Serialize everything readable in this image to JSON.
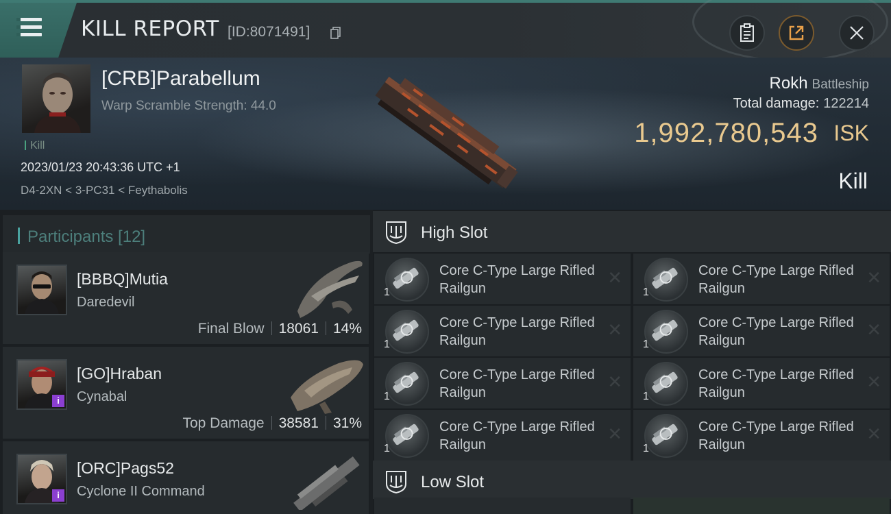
{
  "header": {
    "title": "KILL REPORT",
    "kill_id": "[ID:8071491]"
  },
  "victim": {
    "name": "[CRB]Parabellum",
    "sub": "Warp Scramble Strength: 44.0",
    "tag": "Kill",
    "time": "2023/01/23 20:43:36 UTC +1",
    "location": "D4-2XN < 3-PC31 < Feythabolis",
    "ship_name": "Rokh",
    "ship_class": "Battleship",
    "total_damage_label": "Total damage:",
    "total_damage": "122214",
    "isk_value": "1,992,780,543",
    "isk_unit": "ISK",
    "result": "Kill"
  },
  "participants": {
    "label": "Participants [12]",
    "items": [
      {
        "name": "[BBBQ]Mutia",
        "ship": "Daredevil",
        "stat_label": "Final Blow",
        "damage": "18061",
        "percent": "14%"
      },
      {
        "name": "[GO]Hraban",
        "ship": "Cynabal",
        "stat_label": "Top Damage",
        "damage": "38581",
        "percent": "31%",
        "badge": "i"
      },
      {
        "name": "[ORC]Pags52",
        "ship": "Cyclone II Command",
        "badge": "i"
      }
    ]
  },
  "slots": {
    "high_label": "High Slot",
    "low_label": "Low Slot",
    "high_items": [
      {
        "name": "Core C-Type Large Rifled Railgun",
        "qty": "1"
      },
      {
        "name": "Core C-Type Large Rifled Railgun",
        "qty": "1"
      },
      {
        "name": "Core C-Type Large Rifled Railgun",
        "qty": "1"
      },
      {
        "name": "Core C-Type Large Rifled Railgun",
        "qty": "1"
      },
      {
        "name": "Core C-Type Large Rifled Railgun",
        "qty": "1"
      },
      {
        "name": "Core C-Type Large Rifled Railgun",
        "qty": "1"
      },
      {
        "name": "Core C-Type Large Rifled Railgun",
        "qty": "1"
      },
      {
        "name": "Core C-Type Large Rifled Railgun",
        "qty": "1"
      }
    ],
    "remove_glyph": "✕"
  },
  "colors": {
    "accent": "#4aa3a0",
    "isk_gold": "#e9c98f",
    "badge_purple": "#8b3fd1"
  }
}
